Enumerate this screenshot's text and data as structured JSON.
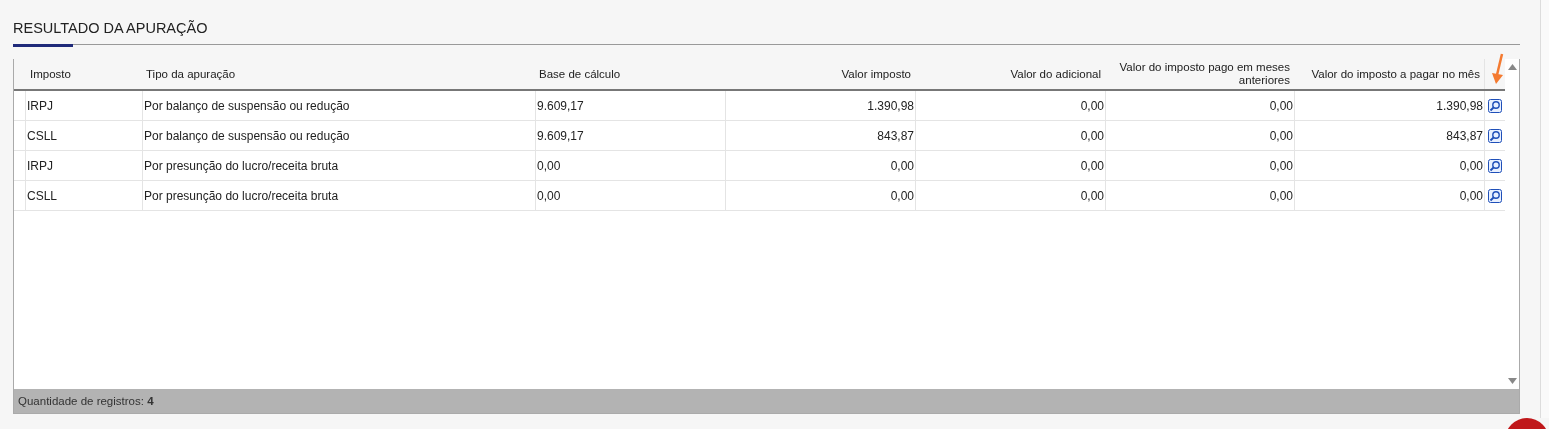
{
  "section": {
    "title": "RESULTADO DA APURAÇÃO"
  },
  "table": {
    "columns": [
      {
        "label": "Imposto"
      },
      {
        "label": "Tipo da apuração"
      },
      {
        "label": "Base de cálculo"
      },
      {
        "label": "Valor imposto"
      },
      {
        "label": "Valor do adicional"
      },
      {
        "label": "Valor do imposto pago em meses anteriores"
      },
      {
        "label": "Valor do imposto a pagar no mês"
      }
    ],
    "rows": [
      {
        "cells": [
          "IRPJ",
          "Por balanço de suspensão ou redução",
          "9.609,17",
          "1.390,98",
          "0,00",
          "0,00",
          "1.390,98"
        ]
      },
      {
        "cells": [
          "CSLL",
          "Por balanço de suspensão ou redução",
          "9.609,17",
          "843,87",
          "0,00",
          "0,00",
          "843,87"
        ]
      },
      {
        "cells": [
          "IRPJ",
          "Por presunção do lucro/receita bruta",
          "0,00",
          "0,00",
          "0,00",
          "0,00",
          "0,00"
        ]
      },
      {
        "cells": [
          "CSLL",
          "Por presunção do lucro/receita bruta",
          "0,00",
          "0,00",
          "0,00",
          "0,00",
          "0,00"
        ]
      }
    ],
    "footer": "Quantidade de registros: **4**"
  }
}
